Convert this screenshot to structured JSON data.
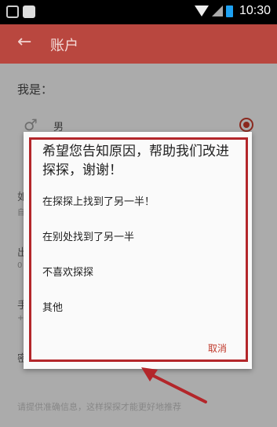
{
  "status_bar": {
    "time": "10:30"
  },
  "app_bar": {
    "title": "账户"
  },
  "settings": {
    "label_iam": "我是：",
    "gender_male": "男",
    "frag_1": "如",
    "frag_1b": "自",
    "frag_2": "出",
    "frag_2b": "0",
    "frag_3": "手",
    "frag_3b": "+",
    "frag_4": "密",
    "footer_hint": "请提供准确信息，这样探探才能更好地推荐"
  },
  "dialog": {
    "title": "希望您告知原因，帮助我们改进探探，谢谢！",
    "options": [
      "在探探上找到了另一半！",
      "在别处找到了另一半",
      "不喜欢探探",
      "其他"
    ],
    "cancel": "取消"
  },
  "colors": {
    "app_bar": "#b9473f",
    "accent": "#c0392b",
    "highlight_frame": "#b3262a"
  }
}
